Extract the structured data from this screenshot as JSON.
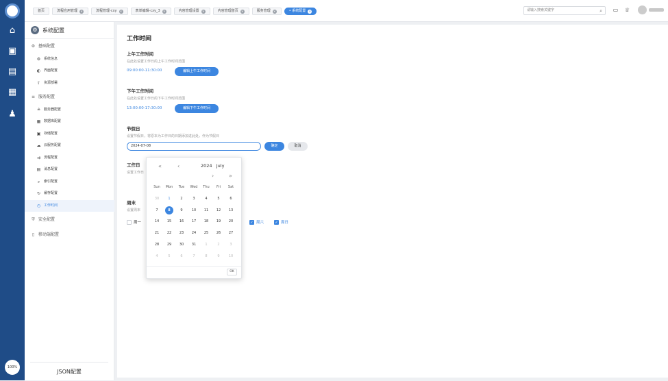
{
  "rail": {
    "items": [
      "home-icon",
      "monitor-user-icon",
      "grid-icon",
      "calendar-icon",
      "user-settings-icon"
    ],
    "zoom": "100%"
  },
  "tabs": [
    {
      "label": "首页",
      "closable": false
    },
    {
      "label": "流程应用管理",
      "closable": true
    },
    {
      "label": "流程管理-cxy",
      "closable": true
    },
    {
      "label": "表单编辑-cxy_3",
      "closable": true
    },
    {
      "label": "内容管理设置",
      "closable": true
    },
    {
      "label": "内容管理首页",
      "closable": true
    },
    {
      "label": "服务管理",
      "closable": true
    },
    {
      "label": "• 系统配置",
      "closable": true,
      "active": true
    }
  ],
  "search": {
    "placeholder": "请输入搜索关键字"
  },
  "sidebar": {
    "title": "系统配置",
    "groups": [
      {
        "label": "基础配置",
        "items": [
          "系统信息",
          "界面配置",
          "资源部署"
        ]
      },
      {
        "label": "服务配置",
        "items": [
          "服务器配置",
          "数据库配置",
          "存储配置",
          "云服务配置",
          "流程配置",
          "消息配置",
          "索引配置",
          "缓存配置",
          "工作时间"
        ]
      },
      {
        "label": "安全配置",
        "items": []
      },
      {
        "label": "移动端配置",
        "items": []
      }
    ],
    "footer": "JSON配置"
  },
  "main": {
    "title": "工作时间",
    "am": {
      "title": "上午工作时间",
      "desc": "在此处设置工作日的上午工作时间范围",
      "value": "09:00:00-11:30:00",
      "button": "编辑上午工作时间"
    },
    "pm": {
      "title": "下午工作时间",
      "desc": "在此处设置工作日的下午工作时间范围",
      "value": "13:00:00-17:30:00",
      "button": "编辑下午工作时间"
    },
    "holiday": {
      "title": "节假日",
      "desc": "设置节假日，将原本为工作日的日期添加进此处，作为节假日",
      "date": "2024-07-08",
      "confirm": "确定",
      "cancel": "取消"
    },
    "workday": {
      "title": "工作日",
      "desc": "设置工作日"
    },
    "weekend": {
      "title": "周末",
      "desc": "设置周末",
      "days": [
        {
          "label": "周一",
          "checked": false
        },
        {
          "label": "周六",
          "checked": true
        },
        {
          "label": "周日",
          "checked": true
        }
      ]
    }
  },
  "calendar": {
    "year": "2024",
    "month": "July",
    "weekdays": [
      "Sun",
      "Mon",
      "Tue",
      "Wed",
      "Thu",
      "Fri",
      "Sat"
    ],
    "days": [
      [
        "30",
        "1",
        "2",
        "3",
        "4",
        "5",
        "6"
      ],
      [
        "7",
        "8",
        "9",
        "10",
        "11",
        "12",
        "13"
      ],
      [
        "14",
        "15",
        "16",
        "17",
        "18",
        "19",
        "20"
      ],
      [
        "21",
        "22",
        "23",
        "24",
        "25",
        "26",
        "27"
      ],
      [
        "28",
        "29",
        "30",
        "31",
        "1",
        "2",
        "3"
      ],
      [
        "4",
        "5",
        "6",
        "7",
        "8",
        "9",
        "10"
      ]
    ],
    "selected": "8",
    "ok": "OK"
  }
}
